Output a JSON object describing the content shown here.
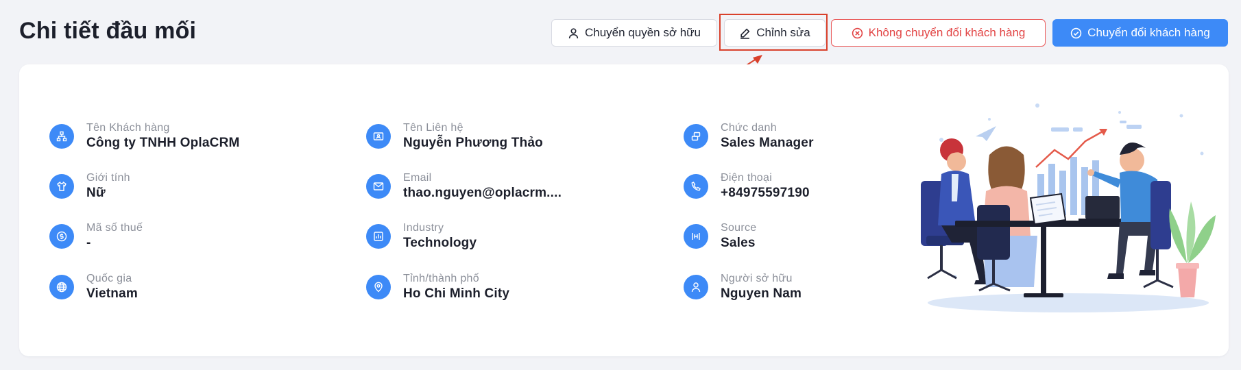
{
  "page": {
    "title": "Chi tiết đầu mối"
  },
  "actions": {
    "transfer_owner": "Chuyển quyền sở hữu",
    "edit": "Chỉnh sửa",
    "reject_convert": "Không chuyển đổi khách hàng",
    "convert": "Chuyển đổi khách hàng"
  },
  "fields": {
    "col1": [
      {
        "label": "Tên Khách hàng",
        "value": "Công ty TNHH OplaCRM",
        "icon": "organization-icon"
      },
      {
        "label": "Giới tính",
        "value": "Nữ",
        "icon": "shirt-icon"
      },
      {
        "label": "Mã số thuế",
        "value": "-",
        "icon": "dollar-coin-icon"
      },
      {
        "label": "Quốc gia",
        "value": "Vietnam",
        "icon": "globe-icon"
      }
    ],
    "col2": [
      {
        "label": "Tên Liên hệ",
        "value": "Nguyễn Phương Thảo",
        "icon": "contact-card-icon"
      },
      {
        "label": "Email",
        "value": "thao.nguyen@oplacrm....",
        "icon": "mail-icon"
      },
      {
        "label": "Industry",
        "value": "Technology",
        "icon": "industry-chart-icon"
      },
      {
        "label": "Tỉnh/thành phố",
        "value": "Ho Chi Minh City",
        "icon": "location-pin-icon"
      }
    ],
    "col3": [
      {
        "label": "Chức danh",
        "value": "Sales Manager",
        "icon": "job-title-icon"
      },
      {
        "label": "Điện thoại",
        "value": "+84975597190",
        "icon": "phone-icon"
      },
      {
        "label": "Source",
        "value": "Sales",
        "icon": "source-icon"
      },
      {
        "label": "Người sở hữu",
        "value": "Nguyen Nam",
        "icon": "user-icon"
      }
    ]
  },
  "colors": {
    "primary": "#3d8af7",
    "danger": "#e24444",
    "annotation": "#d9402b",
    "background": "#f2f3f7"
  }
}
